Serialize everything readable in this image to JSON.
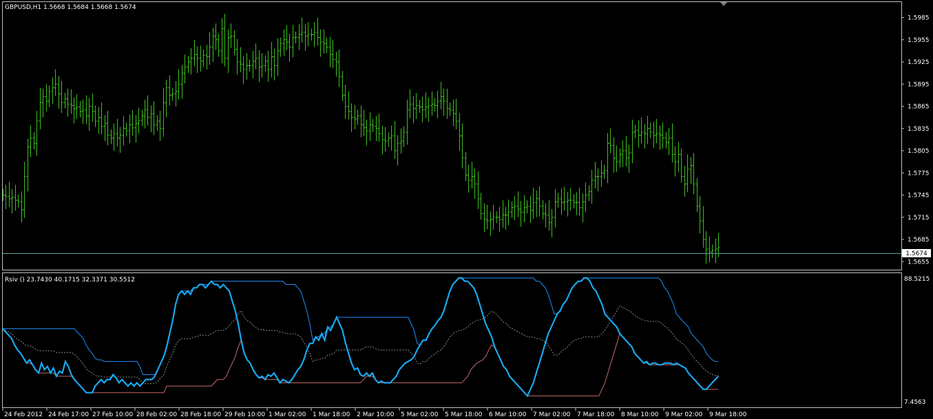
{
  "main_pane": {
    "header": "GBPUSD,H1  1.5668 1.5684 1.5668 1.5674",
    "current_price_label": "1.5674",
    "price_ticks": [
      "1.5985",
      "1.5955",
      "1.5925",
      "1.5895",
      "1.5865",
      "1.5835",
      "1.5805",
      "1.5775",
      "1.5745",
      "1.5715",
      "1.5685",
      "1.5655"
    ]
  },
  "indicator_pane": {
    "header": "Rsiv () 23.7430 40.1715 32.3371 30.5512",
    "max_label": "88.5215",
    "min_label": "7.4563"
  },
  "time_axis": {
    "labels": [
      "24 Feb 2012",
      "24 Feb 17:00",
      "27 Feb 10:00",
      "28 Feb 02:00",
      "28 Feb 18:00",
      "29 Feb 10:00",
      "1 Mar 02:00",
      "1 Mar 18:00",
      "2 Mar 10:00",
      "5 Mar 02:00",
      "5 Mar 18:00",
      "6 Mar 10:00",
      "7 Mar 02:00",
      "7 Mar 18:00",
      "8 Mar 10:00",
      "9 Mar 02:00",
      "9 Mar 18:00"
    ]
  },
  "colors": {
    "background": "#000000",
    "axis": "#c0c0c0",
    "bars": "#3fbf1f",
    "price_line": "#5f9ea0",
    "rsi_main": "#1aa8f0",
    "rsi_band_upper": "#1e90ff",
    "rsi_band_lower": "#c46a6a",
    "rsi_mid_dotted": "#8f8f8f"
  },
  "chart_data": [
    {
      "type": "ohlc",
      "title": "GBPUSD,H1",
      "ylim": [
        1.5645,
        1.6005
      ],
      "close_series": [
        1.5745,
        1.5743,
        1.574,
        1.5742,
        1.5738,
        1.5736,
        1.5725,
        1.577,
        1.581,
        1.5822,
        1.5815,
        1.5845,
        1.587,
        1.5878,
        1.5872,
        1.5885,
        1.589,
        1.5895,
        1.5882,
        1.587,
        1.5875,
        1.5868,
        1.5866,
        1.5862,
        1.5864,
        1.5858,
        1.586,
        1.5852,
        1.5865,
        1.5858,
        1.5845,
        1.585,
        1.5838,
        1.5842,
        1.5826,
        1.5822,
        1.5828,
        1.5822,
        1.5826,
        1.5835,
        1.5832,
        1.584,
        1.5836,
        1.5842,
        1.5846,
        1.5852,
        1.586,
        1.585,
        1.5855,
        1.584,
        1.5845,
        1.5835,
        1.587,
        1.589,
        1.588,
        1.5882,
        1.5885,
        1.5895,
        1.591,
        1.5918,
        1.5925,
        1.593,
        1.5935,
        1.593,
        1.5926,
        1.5934,
        1.5932,
        1.5945,
        1.596,
        1.5955,
        1.594,
        1.597,
        1.593,
        1.5958,
        1.596,
        1.5942,
        1.5925,
        1.5922,
        1.5915,
        1.592,
        1.592,
        1.5926,
        1.593,
        1.5918,
        1.592,
        1.5926,
        1.5915,
        1.5932,
        1.592,
        1.594,
        1.595,
        1.5955,
        1.5952,
        1.5945,
        1.5958,
        1.5958,
        1.5962,
        1.5965,
        1.596,
        1.5962,
        1.5962,
        1.5965,
        1.5958,
        1.5952,
        1.595,
        1.5945,
        1.5935,
        1.5928,
        1.5925,
        1.5905,
        1.588,
        1.5865,
        1.5858,
        1.585,
        1.5848,
        1.5852,
        1.584,
        1.5836,
        1.5832,
        1.584,
        1.5838,
        1.5835,
        1.5828,
        1.582,
        1.5818,
        1.5822,
        1.5825,
        1.5805,
        1.5815,
        1.5818,
        1.583,
        1.586,
        1.5868,
        1.5862,
        1.5866,
        1.5864,
        1.586,
        1.5864,
        1.5866,
        1.5868,
        1.5866,
        1.5872,
        1.5878,
        1.5872,
        1.5862,
        1.586,
        1.5855,
        1.5845,
        1.5825,
        1.5795,
        1.5772,
        1.5765,
        1.577,
        1.576,
        1.574,
        1.572,
        1.5712,
        1.571,
        1.5712,
        1.5715,
        1.5715,
        1.5712,
        1.5718,
        1.5718,
        1.5722,
        1.5728,
        1.573,
        1.5726,
        1.5722,
        1.5728,
        1.573,
        1.5724,
        1.5735,
        1.574,
        1.573,
        1.572,
        1.5718,
        1.5708,
        1.5715,
        1.5736,
        1.574,
        1.5735,
        1.5736,
        1.5738,
        1.5738,
        1.5735,
        1.5735,
        1.5728,
        1.5736,
        1.5745,
        1.575,
        1.5765,
        1.577,
        1.577,
        1.5775,
        1.5778,
        1.5815,
        1.5812,
        1.5795,
        1.579,
        1.58,
        1.5805,
        1.5795,
        1.5802,
        1.583,
        1.5832,
        1.5826,
        1.583,
        1.5828,
        1.5835,
        1.583,
        1.5826,
        1.5828,
        1.5826,
        1.5822,
        1.5816,
        1.5822,
        1.58,
        1.579,
        1.58,
        1.577,
        1.576,
        1.578,
        1.5785,
        1.576,
        1.573,
        1.571,
        1.5685,
        1.5672,
        1.5668,
        1.567,
        1.5672,
        1.5674
      ]
    },
    {
      "type": "line",
      "title": "Rsiv ()",
      "ylim": [
        7.4563,
        88.5215
      ],
      "series": [
        {
          "color": "#1aa8f0",
          "values": [
            55,
            53,
            51,
            49,
            45,
            42,
            40,
            37,
            34,
            36,
            33,
            30,
            28,
            34,
            30,
            32,
            28,
            31,
            26,
            29,
            28,
            35,
            32,
            27,
            24,
            22,
            20,
            18,
            16,
            16,
            16,
            20,
            22,
            24,
            22,
            24,
            24,
            27,
            25,
            22,
            24,
            22,
            20,
            22,
            20,
            22,
            20,
            22,
            24,
            24,
            24,
            26,
            30,
            34,
            38,
            44,
            52,
            60,
            70,
            76,
            78,
            76,
            78,
            76,
            80,
            80,
            82,
            82,
            80,
            82,
            84,
            82,
            82,
            80,
            82,
            80,
            78,
            72,
            66,
            58,
            48,
            40,
            36,
            34,
            30,
            27,
            25,
            26,
            24,
            27,
            26,
            28,
            25,
            22,
            24,
            23,
            22,
            24,
            27,
            30,
            32,
            36,
            42,
            46,
            46,
            50,
            48,
            52,
            48,
            56,
            54,
            58,
            62,
            58,
            54,
            46,
            40,
            34,
            30,
            31,
            27,
            26,
            28,
            26,
            28,
            24,
            22,
            23,
            22,
            22,
            22,
            24,
            26,
            30,
            32,
            34,
            35,
            36,
            38,
            42,
            45,
            48,
            48,
            52,
            55,
            57,
            60,
            62,
            66,
            72,
            78,
            82,
            84,
            86,
            86,
            84,
            84,
            82,
            80,
            76,
            70,
            64,
            58,
            54,
            50,
            44,
            40,
            36,
            32,
            30,
            26,
            24,
            22,
            20,
            18,
            16,
            14,
            18,
            22,
            28,
            34,
            40,
            46,
            52,
            56,
            60,
            64,
            66,
            70,
            72,
            76,
            80,
            82,
            84,
            84,
            86,
            86,
            84,
            80,
            78,
            74,
            70,
            64,
            62,
            60,
            58,
            56,
            52,
            50,
            48,
            46,
            44,
            40,
            38,
            36,
            34,
            35,
            33,
            34,
            34,
            33,
            33,
            34,
            34,
            34,
            33,
            34,
            33,
            32,
            31,
            28,
            26,
            24,
            22,
            20,
            18,
            18,
            20,
            22,
            24,
            26
          ]
        }
      ]
    }
  ]
}
